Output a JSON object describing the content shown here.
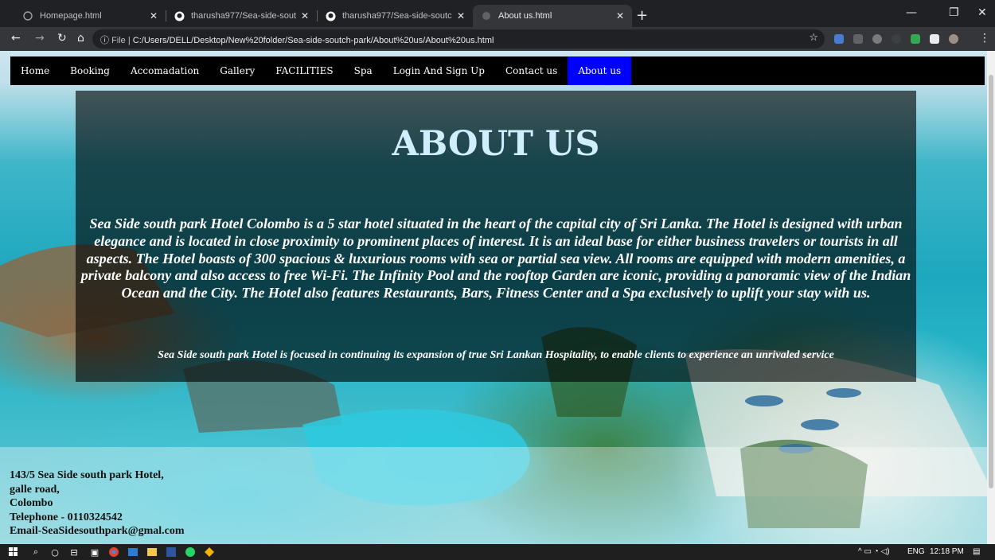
{
  "browser": {
    "tabs": [
      {
        "title": "Homepage.html",
        "icon": "page-icon",
        "active": false
      },
      {
        "title": "tharusha977/Sea-side-soutch-pa",
        "icon": "github-icon",
        "active": false
      },
      {
        "title": "tharusha977/Sea-side-soutch-pa",
        "icon": "github-icon",
        "active": false
      },
      {
        "title": "About us.html",
        "icon": "page-icon",
        "active": true
      }
    ],
    "new_tab": "+",
    "url_scheme": "File",
    "url_path": "C:/Users/DELL/Desktop/New%20folder/Sea-side-soutch-park/About%20us/About%20us.html"
  },
  "site": {
    "nav": [
      "Home",
      "Booking",
      "Accomadation",
      "Gallery",
      "FACILITIES",
      "Spa",
      "Login And Sign Up",
      "Contact us",
      "About us"
    ],
    "active_nav": "About us",
    "heading": "ABOUT US",
    "description": "Sea Side south park Hotel Colombo is a 5 star hotel situated in the heart of the capital city of Sri Lanka. The Hotel is designed with urban elegance and is located in close proximity to prominent places of interest. It is an ideal base for either business travelers or tourists in all aspects. The Hotel boasts of 300 spacious & luxurious rooms with sea or partial sea view. All rooms are equipped with modern amenities, a private balcony and also access to free Wi-Fi. The Infinity Pool and the rooftop Garden are iconic, providing a panoramic view of the Indian Ocean and the City. The Hotel also features Restaurants, Bars, Fitness Center and a Spa exclusively to uplift your stay with us.",
    "focus": "Sea Side south park Hotel is focused in continuing its expansion of true Sri Lankan Hospitality, to enable clients to experience an unrivaled service",
    "footer": {
      "address_1": "143/5 Sea Side south park Hotel,",
      "address_2": "galle road,",
      "address_3": "Colombo",
      "telephone": "Telephone - 0110324542",
      "email": "Email-SeaSidesouthpark@gmal.com"
    }
  },
  "taskbar": {
    "lang": "ENG",
    "time": "12:18 PM"
  },
  "colors": {
    "nav_active": "#0000ff",
    "heading": "#cfefff",
    "panel": "rgba(0,0,0,0.62)"
  }
}
